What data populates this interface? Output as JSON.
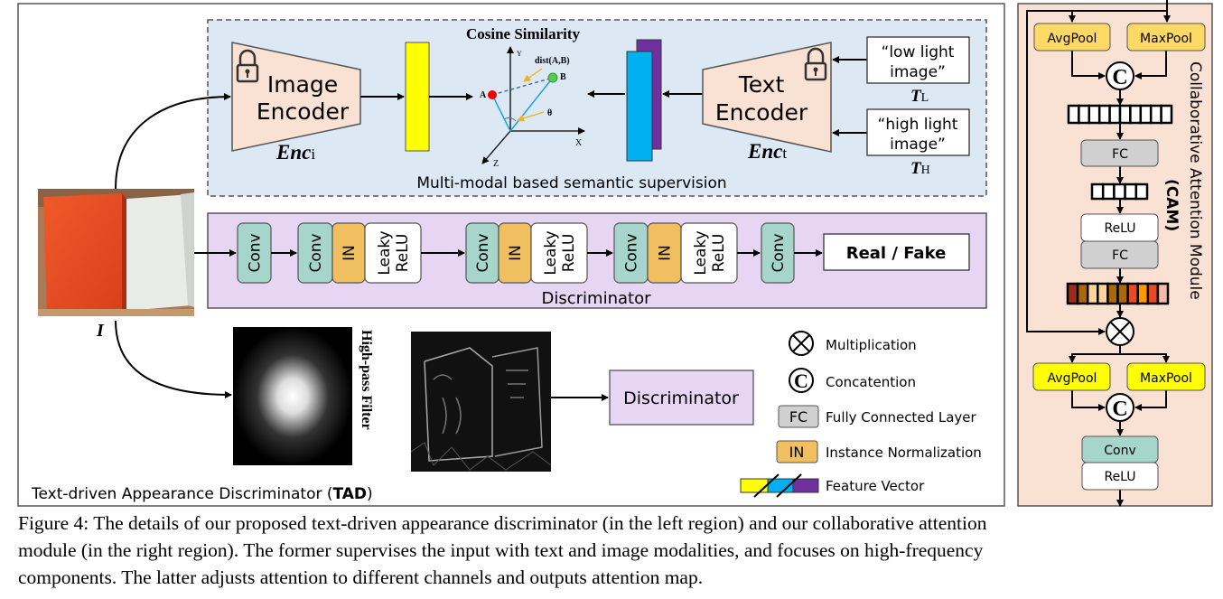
{
  "tad": {
    "title_prefix": "Text-driven Appearance Discriminator (",
    "title_bold": "TAD",
    "title_suffix": ")"
  },
  "semantic": {
    "label": "Multi-modal based semantic supervision",
    "cosine_title": "Cosine Similarity",
    "dist_label": "dist(A,B)",
    "point_a": "A",
    "point_b": "B",
    "theta": "θ",
    "axis_x": "X",
    "axis_y": "Y",
    "axis_z": "Z",
    "image_encoder": [
      "Image",
      "Encoder"
    ],
    "enc_i": "Enc",
    "enc_i_sub": "i",
    "text_encoder": [
      "Text",
      "Encoder"
    ],
    "enc_t": "Enc",
    "enc_t_sub": "t",
    "prompts": [
      {
        "lines": [
          "“low light",
          "image”"
        ],
        "symbol": "T",
        "sub": "L"
      },
      {
        "lines": [
          "“high light",
          "image”"
        ],
        "symbol": "T",
        "sub": "H"
      }
    ]
  },
  "discriminator": {
    "label": "Discriminator",
    "conv": "Conv",
    "in": "IN",
    "leaky": [
      "Leaky",
      "ReLU"
    ],
    "output": "Real / Fake"
  },
  "input_label": "I",
  "highpass_label": "High-pass Filter",
  "discriminator2_label": "Discriminator",
  "legend": [
    {
      "symbol": "multiply-circle",
      "label": "Multiplication"
    },
    {
      "symbol": "C",
      "label": "Concatention"
    },
    {
      "symbol": "FC",
      "label": "Fully Connected Layer"
    },
    {
      "symbol": "IN",
      "label": "Instance Normalization"
    },
    {
      "symbol": "feature-vector",
      "label": "Feature Vector"
    }
  ],
  "cam": {
    "title": "Collaborative Attention Module",
    "abbr": "(CAM)",
    "avgpool": "AvgPool",
    "maxpool": "MaxPool",
    "fc": "FC",
    "relu": "ReLU",
    "conv": "Conv",
    "concat": "C",
    "attention_colors": [
      "#9b2c17",
      "#a9680a",
      "#fdd59b",
      "#fdd59b",
      "#a9680a",
      "#a9680a",
      "#e84a25",
      "#fe9900",
      "#e84a25",
      "#f6b9aa"
    ]
  },
  "colors": {
    "semantic_bg": "#dde8f5",
    "disc_bg": "#e6d6f3",
    "cam_bg": "#f9e2d4",
    "encoder": "#f9e2d4",
    "conv": "#a5d5cb",
    "in": "#f0c060",
    "fc": "#d0d0d0",
    "pool_top": "#ffd966",
    "pool_bottom": "#ffff00",
    "feature_yellow": "#ffff00",
    "feature_blue": "#00b0f0",
    "feature_purple": "#7030a0"
  },
  "caption": [
    "Figure 4: The details of our proposed text-driven appearance discriminator (in the left region) and our collaborative attention",
    "module (in the right region). The former supervises the input with text and image modalities, and focuses on high-frequency",
    "components. The latter adjusts attention to different channels and outputs attention map."
  ]
}
